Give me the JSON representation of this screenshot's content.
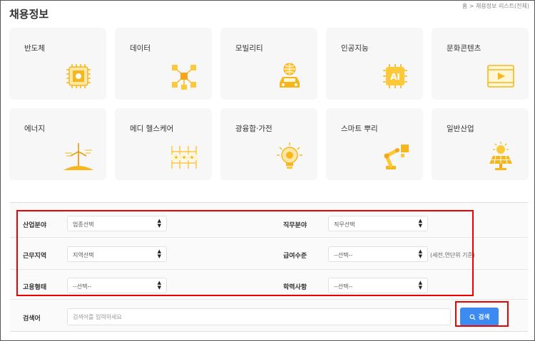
{
  "page": {
    "title": "채용정보",
    "breadcrumb": "홈 > 채용정보 리스트(전체)"
  },
  "categories": [
    {
      "label": "반도체",
      "icon": "chip-icon"
    },
    {
      "label": "데이터",
      "icon": "data-network-icon"
    },
    {
      "label": "모빌리티",
      "icon": "car-globe-icon"
    },
    {
      "label": "인공지능",
      "icon": "ai-chip-icon"
    },
    {
      "label": "문화콘텐츠",
      "icon": "video-player-icon"
    },
    {
      "label": "에너지",
      "icon": "wind-turbine-icon"
    },
    {
      "label": "메디 헬스케어",
      "icon": "medical-building-icon"
    },
    {
      "label": "광융합·가전",
      "icon": "light-bulb-icon"
    },
    {
      "label": "스마트 뿌리",
      "icon": "robot-arm-icon"
    },
    {
      "label": "일반산업",
      "icon": "solar-panel-icon"
    }
  ],
  "filters": {
    "industry": {
      "label": "산업분야",
      "value": "업종선택"
    },
    "job": {
      "label": "직무분야",
      "value": "직무선택"
    },
    "region": {
      "label": "근무지역",
      "value": "지역선택"
    },
    "salary": {
      "label": "급여수준",
      "value": "--선택--",
      "note": "(세전,연단위 기준)"
    },
    "employment": {
      "label": "고용형태",
      "value": "--선택--"
    },
    "education": {
      "label": "학력사항",
      "value": "--선택--"
    },
    "search": {
      "label": "검색어",
      "placeholder": "검색어를 입력하세요",
      "button": "검색"
    }
  },
  "colors": {
    "accent": "#3d8bf0",
    "icon": "#f7b71a",
    "highlight": "#e00000"
  }
}
